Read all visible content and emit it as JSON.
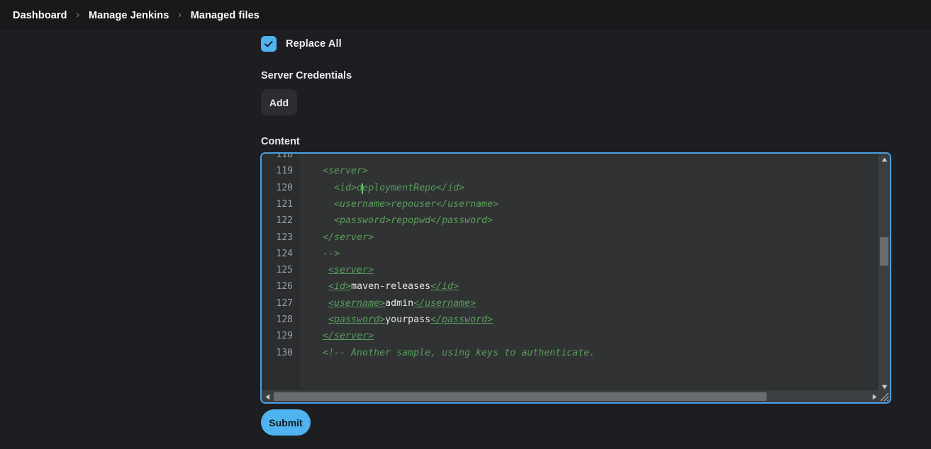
{
  "breadcrumb": {
    "items": [
      {
        "label": "Dashboard"
      },
      {
        "label": "Manage Jenkins"
      },
      {
        "label": "Managed files"
      }
    ],
    "separator": "›"
  },
  "form": {
    "replace_all": {
      "label": "Replace All",
      "checked": true,
      "icon": "check-icon"
    },
    "server_credentials": {
      "label": "Server Credentials",
      "add_button": "Add"
    },
    "content": {
      "label": "Content"
    },
    "submit_button": "Submit"
  },
  "editor": {
    "first_visible_line": 118,
    "lines": [
      {
        "num": "118",
        "tokens": []
      },
      {
        "num": "119",
        "tokens": [
          {
            "t": "comment",
            "s": "    <server>"
          }
        ]
      },
      {
        "num": "120",
        "tokens": [
          {
            "t": "comment",
            "s": "      <id>deploymentRepo</id>"
          }
        ]
      },
      {
        "num": "121",
        "tokens": [
          {
            "t": "comment",
            "s": "      <username>repouser</username>"
          }
        ]
      },
      {
        "num": "122",
        "tokens": [
          {
            "t": "comment",
            "s": "      <password>repopwd</password>"
          }
        ]
      },
      {
        "num": "123",
        "tokens": [
          {
            "t": "comment",
            "s": "    </server>"
          }
        ]
      },
      {
        "num": "124",
        "tokens": [
          {
            "t": "comment",
            "s": "    -->"
          }
        ]
      },
      {
        "num": "125",
        "tokens": [
          {
            "t": "text",
            "s": "     "
          },
          {
            "t": "tag",
            "s": "<server>"
          }
        ]
      },
      {
        "num": "126",
        "tokens": [
          {
            "t": "text",
            "s": "     "
          },
          {
            "t": "tag",
            "s": "<id>"
          },
          {
            "t": "text",
            "s": "maven-releases"
          },
          {
            "t": "tag",
            "s": "</id>"
          }
        ]
      },
      {
        "num": "127",
        "tokens": [
          {
            "t": "text",
            "s": "     "
          },
          {
            "t": "tag",
            "s": "<username>"
          },
          {
            "t": "text",
            "s": "admin"
          },
          {
            "t": "tag",
            "s": "</username>"
          }
        ]
      },
      {
        "num": "128",
        "tokens": [
          {
            "t": "text",
            "s": "     "
          },
          {
            "t": "tag",
            "s": "<password>"
          },
          {
            "t": "text",
            "s": "yourpass"
          },
          {
            "t": "tag",
            "s": "</password>"
          }
        ]
      },
      {
        "num": "129",
        "tokens": [
          {
            "t": "text",
            "s": "    "
          },
          {
            "t": "tag",
            "s": "</server>"
          }
        ]
      },
      {
        "num": "130",
        "tokens": [
          {
            "t": "comment",
            "s": "    <!-- Another sample, using keys to authenticate."
          }
        ]
      }
    ],
    "scrollbars": {
      "vertical_up_icon": "triangle-up-icon",
      "vertical_down_icon": "triangle-down-icon",
      "horizontal_left_icon": "triangle-left-icon",
      "horizontal_right_icon": "triangle-right-icon",
      "resize_grip_icon": "resize-grip-icon"
    }
  },
  "colors": {
    "accent": "#4fb3f0",
    "page_bg": "#1c1e21",
    "header_bg": "#18191b",
    "editor_bg": "#303234",
    "gutter_bg": "#2b2d2f",
    "code_comment": "#5a9e5a",
    "code_text": "#e8e8e8",
    "editor_border": "#4a9fe0"
  }
}
